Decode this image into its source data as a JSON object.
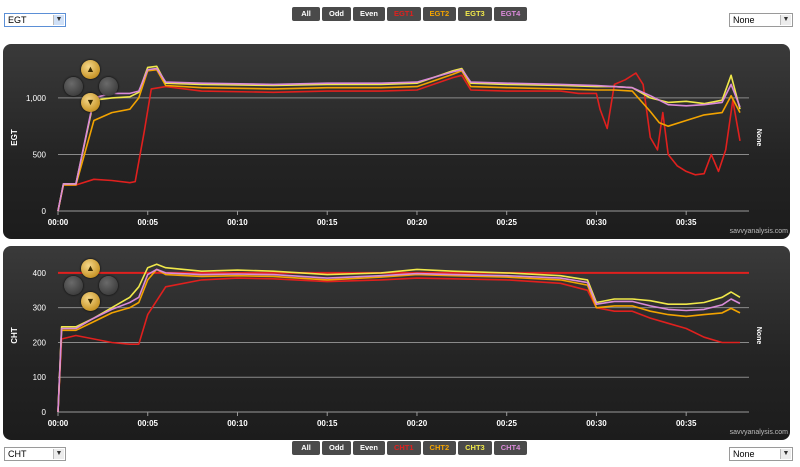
{
  "top_controls": {
    "left_select": "EGT",
    "right_select": "None",
    "buttons": [
      "All",
      "Odd",
      "Even",
      "EGT1",
      "EGT2",
      "EGT3",
      "EGT4"
    ],
    "button_colors": [
      "#ffffff",
      "#ffffff",
      "#ffffff",
      "#e0201e",
      "#f2a300",
      "#f0e84a",
      "#d98ad9"
    ]
  },
  "bottom_controls": {
    "left_select": "CHT",
    "right_select": "None",
    "buttons": [
      "All",
      "Odd",
      "Even",
      "CHT1",
      "CHT2",
      "CHT3",
      "CHT4"
    ],
    "button_colors": [
      "#ffffff",
      "#ffffff",
      "#ffffff",
      "#e0201e",
      "#f2a300",
      "#f0e84a",
      "#d98ad9"
    ]
  },
  "chart_data": [
    {
      "type": "line",
      "ylabel": "EGT",
      "right_label": "None",
      "watermark": "savvyanalysis.com",
      "xlim": [
        0,
        38.5
      ],
      "ylim": [
        0,
        1300
      ],
      "yticks": [
        0,
        500,
        1000
      ],
      "ytick_labels": [
        "0",
        "500",
        "1,000"
      ],
      "xticks": [
        0,
        5,
        10,
        15,
        20,
        25,
        30,
        35
      ],
      "xtick_labels": [
        "00:00",
        "00:05",
        "00:10",
        "00:15",
        "00:20",
        "00:25",
        "00:30",
        "00:35"
      ],
      "grid": true,
      "series": [
        {
          "color": "#e0201e",
          "x": [
            0,
            0.3,
            1,
            2,
            3,
            4,
            4.3,
            4.8,
            5.2,
            6,
            8,
            12,
            15,
            18,
            20,
            22,
            22.5,
            23,
            25,
            28,
            29,
            30,
            30.2,
            30.6,
            31,
            31.6,
            32.2,
            32.6,
            33,
            33.4,
            33.7,
            34,
            34.5,
            35,
            35.5,
            36,
            36.4,
            36.8,
            37.2,
            37.6,
            38
          ],
          "y": [
            0,
            230,
            230,
            280,
            270,
            250,
            260,
            700,
            1080,
            1100,
            1060,
            1050,
            1060,
            1060,
            1070,
            1180,
            1200,
            1070,
            1060,
            1060,
            1040,
            1040,
            900,
            730,
            1120,
            1160,
            1220,
            1120,
            650,
            540,
            870,
            500,
            400,
            350,
            320,
            330,
            500,
            350,
            540,
            980,
            620
          ]
        },
        {
          "color": "#f2a300",
          "x": [
            0,
            0.3,
            1,
            2,
            3,
            4,
            4.5,
            5,
            5.5,
            6,
            8,
            12,
            15,
            18,
            20,
            22,
            22.5,
            23,
            25,
            28,
            30,
            31,
            32,
            33,
            33.5,
            34,
            35,
            36,
            37,
            37.5,
            38
          ],
          "y": [
            0,
            230,
            230,
            800,
            870,
            900,
            1000,
            1240,
            1250,
            1110,
            1090,
            1080,
            1090,
            1090,
            1100,
            1210,
            1240,
            1100,
            1090,
            1080,
            1070,
            1070,
            1060,
            880,
            780,
            750,
            800,
            850,
            870,
            1020,
            870
          ]
        },
        {
          "color": "#f0e84a",
          "x": [
            0,
            0.3,
            1,
            2,
            3,
            4,
            4.5,
            5,
            5.5,
            6,
            8,
            12,
            15,
            18,
            20,
            22,
            22.5,
            23,
            25,
            28,
            30,
            31,
            32,
            33,
            34,
            35,
            36,
            37,
            37.5,
            38
          ],
          "y": [
            0,
            240,
            240,
            980,
            1000,
            1010,
            1050,
            1270,
            1280,
            1130,
            1120,
            1110,
            1120,
            1120,
            1130,
            1240,
            1260,
            1130,
            1120,
            1110,
            1100,
            1100,
            1090,
            1000,
            960,
            970,
            950,
            980,
            1200,
            900
          ]
        },
        {
          "color": "#d98ad9",
          "x": [
            0,
            0.3,
            1,
            2,
            3,
            4,
            4.5,
            5,
            5.5,
            6,
            8,
            12,
            15,
            18,
            20,
            22,
            22.5,
            23,
            25,
            28,
            30,
            31,
            32,
            33,
            34,
            35,
            36,
            37,
            37.5,
            38
          ],
          "y": [
            0,
            240,
            240,
            1000,
            1040,
            1040,
            1060,
            1250,
            1260,
            1140,
            1130,
            1120,
            1130,
            1130,
            1140,
            1230,
            1250,
            1140,
            1130,
            1120,
            1110,
            1100,
            1090,
            1020,
            940,
            930,
            940,
            960,
            1120,
            920
          ]
        }
      ]
    },
    {
      "type": "line",
      "ylabel": "CHT",
      "right_label": "None",
      "watermark": "savvyanalysis.com",
      "xlim": [
        0,
        38.5
      ],
      "ylim": [
        0,
        440
      ],
      "yticks": [
        0,
        100,
        200,
        300,
        400
      ],
      "ytick_labels": [
        "0",
        "100",
        "200",
        "300",
        "400"
      ],
      "xticks": [
        0,
        5,
        10,
        15,
        20,
        25,
        30,
        35
      ],
      "xtick_labels": [
        "00:00",
        "00:05",
        "00:10",
        "00:15",
        "00:20",
        "00:25",
        "00:30",
        "00:35"
      ],
      "grid": true,
      "limit_line": {
        "value": 400,
        "color": "#e0201e"
      },
      "series": [
        {
          "color": "#e0201e",
          "x": [
            0,
            0.2,
            1,
            2,
            3,
            4,
            4.5,
            5,
            6,
            8,
            10,
            12,
            15,
            18,
            20,
            22,
            25,
            28,
            29.5,
            30,
            31,
            32,
            33,
            34,
            35,
            36,
            37,
            38
          ],
          "y": [
            0,
            210,
            220,
            210,
            200,
            195,
            195,
            280,
            360,
            380,
            385,
            383,
            375,
            380,
            385,
            383,
            380,
            370,
            350,
            300,
            290,
            290,
            270,
            255,
            240,
            215,
            200,
            200
          ]
        },
        {
          "color": "#f2a300",
          "x": [
            0,
            0.2,
            1,
            2,
            3,
            4,
            4.5,
            5,
            5.5,
            6,
            8,
            10,
            12,
            15,
            18,
            20,
            22,
            25,
            28,
            29.5,
            30,
            31,
            32,
            33,
            34,
            35,
            36,
            37,
            37.5,
            38
          ],
          "y": [
            0,
            235,
            235,
            260,
            285,
            300,
            315,
            380,
            410,
            395,
            390,
            392,
            390,
            380,
            388,
            395,
            392,
            388,
            380,
            365,
            300,
            305,
            305,
            290,
            280,
            275,
            280,
            285,
            298,
            285
          ]
        },
        {
          "color": "#f0e84a",
          "x": [
            0,
            0.2,
            1,
            2,
            3,
            4,
            4.5,
            5,
            5.5,
            6,
            8,
            10,
            12,
            15,
            18,
            20,
            22,
            25,
            28,
            29.5,
            30,
            31,
            32,
            33,
            34,
            35,
            36,
            37,
            37.5,
            38
          ],
          "y": [
            0,
            245,
            245,
            270,
            300,
            330,
            360,
            415,
            425,
            415,
            405,
            408,
            405,
            395,
            400,
            410,
            405,
            400,
            392,
            380,
            315,
            325,
            325,
            320,
            310,
            310,
            315,
            330,
            345,
            330
          ]
        },
        {
          "color": "#d98ad9",
          "x": [
            0,
            0.2,
            1,
            2,
            3,
            4,
            4.5,
            5,
            5.5,
            6,
            8,
            10,
            12,
            15,
            18,
            20,
            22,
            25,
            28,
            29.5,
            30,
            31,
            32,
            33,
            34,
            35,
            36,
            37,
            37.5,
            38
          ],
          "y": [
            0,
            240,
            240,
            270,
            295,
            315,
            330,
            395,
            410,
            400,
            395,
            397,
            395,
            385,
            392,
            398,
            395,
            392,
            385,
            372,
            310,
            318,
            318,
            305,
            295,
            292,
            295,
            308,
            325,
            312
          ]
        }
      ]
    }
  ]
}
